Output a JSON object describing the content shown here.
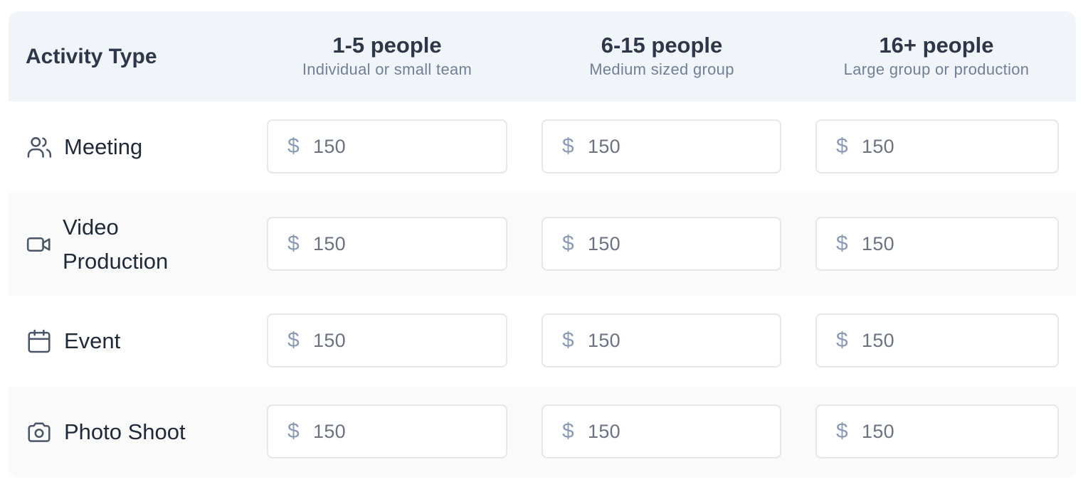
{
  "header": {
    "activity_type_label": "Activity Type",
    "columns": [
      {
        "title": "1-5 people",
        "subtitle": "Individual or small team"
      },
      {
        "title": "6-15 people",
        "subtitle": "Medium sized group"
      },
      {
        "title": "16+ people",
        "subtitle": "Large group or production"
      }
    ]
  },
  "currency_symbol": "$",
  "rows": [
    {
      "name": "Meeting",
      "icon": "users-icon",
      "prices": [
        "150",
        "150",
        "150"
      ]
    },
    {
      "name": "Video Production",
      "icon": "video-camera-icon",
      "prices": [
        "150",
        "150",
        "150"
      ]
    },
    {
      "name": "Event",
      "icon": "calendar-icon",
      "prices": [
        "150",
        "150",
        "150"
      ]
    },
    {
      "name": "Photo Shoot",
      "icon": "camera-icon",
      "prices": [
        "150",
        "150",
        "150"
      ]
    }
  ],
  "colors": {
    "header_bg": "#f1f4f9",
    "alt_row_bg": "#fafafa",
    "input_border": "#e5e7eb",
    "dollar_color": "#8a9ab4"
  }
}
